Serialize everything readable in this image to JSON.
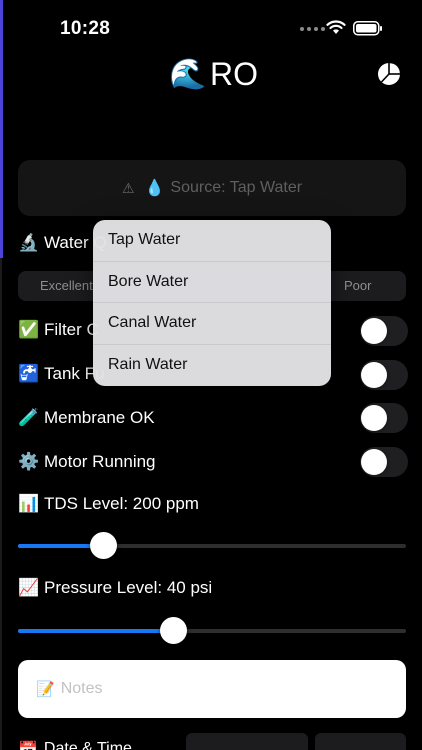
{
  "status_bar": {
    "time": "10:28"
  },
  "header": {
    "title": "RO",
    "wave_icon": "🌊",
    "stats_icon": "pie-chart-icon"
  },
  "source": {
    "warning_icon": "⚠",
    "drop_icon": "💧",
    "label": "Source: Tap Water"
  },
  "water_quality": {
    "emoji": "🔬",
    "label": "Water Q",
    "segments": [
      "Excellent",
      "Poor"
    ]
  },
  "toggles": [
    {
      "emoji": "✅",
      "label": "Filter C",
      "on": false
    },
    {
      "emoji": "🚰",
      "label": "Tank Fu",
      "on": false
    },
    {
      "emoji": "🧪",
      "label": "Membrane OK",
      "on": false
    },
    {
      "emoji": "⚙️",
      "label": "Motor Running",
      "on": false
    }
  ],
  "tds": {
    "emoji": "📊",
    "label": "TDS Level: 200 ppm",
    "value_fraction": 0.22
  },
  "pressure": {
    "emoji": "📈",
    "label": "Pressure Level: 40 psi",
    "value_fraction": 0.4
  },
  "notes": {
    "emoji": "📝",
    "placeholder": "Notes"
  },
  "date_time": {
    "emoji": "📅",
    "label": "Date & Time"
  },
  "source_menu": {
    "options": [
      "Tap Water",
      "Bore Water",
      "Canal Water",
      "Rain Water"
    ]
  },
  "colors": {
    "accent": "#1877f2",
    "background": "#000000"
  }
}
